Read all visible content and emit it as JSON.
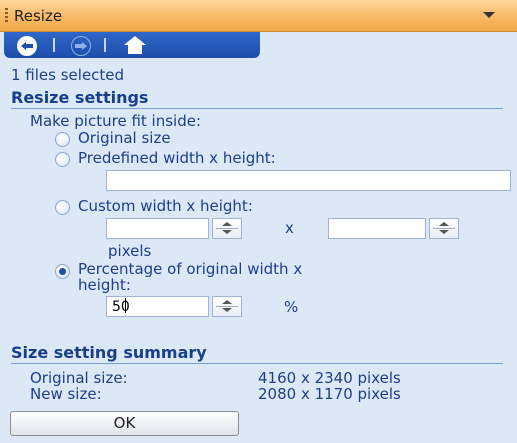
{
  "panel": {
    "title": "Resize"
  },
  "status": {
    "files_selected": "1 files selected"
  },
  "resize_settings": {
    "header": "Resize settings",
    "fit_label": "Make picture fit inside:",
    "options": [
      {
        "label": "Original size",
        "checked": false
      },
      {
        "label": "Predefined width x height:",
        "checked": false
      },
      {
        "label": "Custom width x height:",
        "checked": false
      },
      {
        "label": "Percentage of original width x",
        "label2": "height:",
        "checked": true
      }
    ],
    "predefined_value": "",
    "custom_width": "",
    "custom_height": "",
    "x_sep": "x",
    "units": "pixels",
    "percentage_value": "50",
    "percent_sign": "%"
  },
  "summary": {
    "header": "Size setting summary",
    "original_label": "Original size:",
    "original_value": "4160 x 2340 pixels",
    "new_label": "New size:",
    "new_value": "2080 x 1170 pixels"
  },
  "buttons": {
    "ok": "OK"
  },
  "icons": [
    "back-arrow-icon",
    "forward-arrow-icon",
    "home-icon",
    "grip-icon",
    "collapse-chevron-icon"
  ],
  "colors": {
    "title_bar": "#f7b865",
    "panel_bg": "#dde8f7",
    "nav_bar": "#1d4faa",
    "text": "#1d3f8a"
  }
}
